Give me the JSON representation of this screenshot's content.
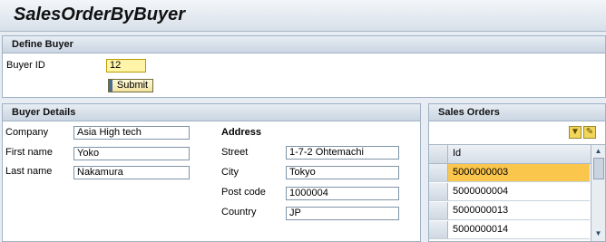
{
  "app": {
    "title": "SalesOrderByBuyer"
  },
  "define_buyer": {
    "header": "Define Buyer",
    "buyer_id_label": "Buyer ID",
    "buyer_id_value": "12",
    "submit_label": "Submit"
  },
  "buyer_details": {
    "header": "Buyer Details",
    "company_label": "Company",
    "company_value": "Asia High tech",
    "first_name_label": "First name",
    "first_name_value": "Yoko",
    "last_name_label": "Last name",
    "last_name_value": "Nakamura",
    "address_title": "Address",
    "street_label": "Street",
    "street_value": "1-7-2 Ohtemachi",
    "city_label": "City",
    "city_value": "Tokyo",
    "post_code_label": "Post code",
    "post_code_value": "1000004",
    "country_label": "Country",
    "country_value": "JP"
  },
  "sales_orders": {
    "header": "Sales Orders",
    "column_id": "Id",
    "rows": [
      "5000000003",
      "5000000004",
      "5000000013",
      "5000000014"
    ],
    "selected_row": 0,
    "icons": [
      "filter-icon",
      "settings-icon"
    ]
  },
  "colors": {
    "selected_row": "#fbc64c",
    "active_field": "#fff4a8",
    "panel_border": "#9fb1c4"
  }
}
